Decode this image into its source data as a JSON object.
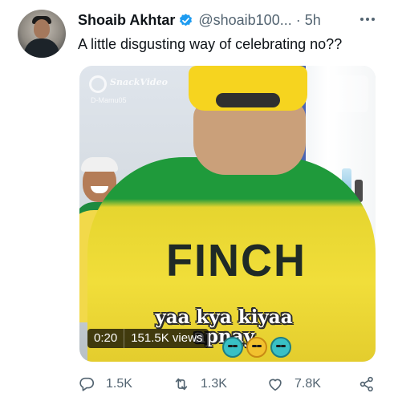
{
  "tweet": {
    "author_name": "Shoaib Akhtar",
    "author_handle": "@shoaib100...",
    "separator": "·",
    "time": "5h",
    "text": "A little disgusting way of celebrating no??"
  },
  "media": {
    "jersey_name": "FINCH",
    "caption_line1": "yaa kya kiyaa",
    "caption_line2": "apnay",
    "watermark_name": "SnackVideo",
    "watermark_user": "D-Mamu05",
    "duration": "0:20",
    "views": "151.5K views"
  },
  "actions": {
    "replies": "1.5K",
    "retweets": "1.3K",
    "likes": "7.8K"
  },
  "icons": {
    "verified": "verified-badge-icon",
    "more": "more-options-icon",
    "reply": "reply-icon",
    "retweet": "retweet-icon",
    "like": "heart-icon",
    "share": "share-icon"
  },
  "colors": {
    "verified_blue": "#1d9bf0",
    "secondary_text": "#536471",
    "primary_text": "#0f1419"
  }
}
